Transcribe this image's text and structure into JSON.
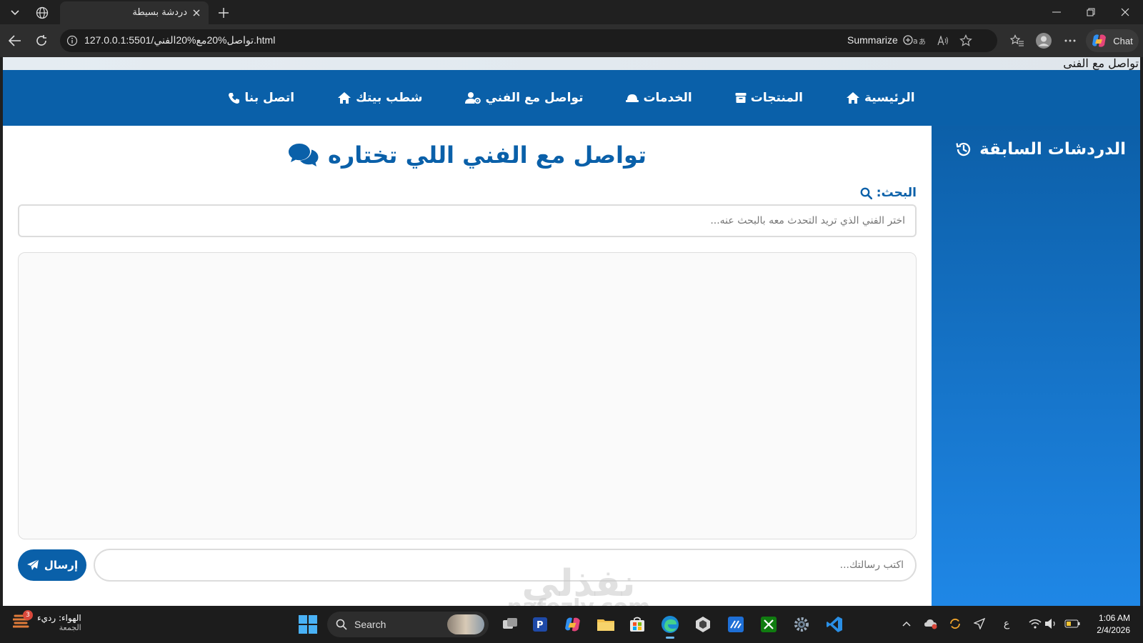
{
  "browser": {
    "tab_title": "دردشة بسيطة",
    "url": "127.0.0.1:5501/تواصل%20مع%20الفني.html",
    "summarize_label": "Summarize",
    "chat_label": "Chat"
  },
  "page": {
    "document_title": "تواصل مع الفنى",
    "nav": [
      {
        "label": "الرئيسية",
        "icon": "home-icon"
      },
      {
        "label": "المنتجات",
        "icon": "box-icon"
      },
      {
        "label": "الخدمات",
        "icon": "hard-hat-icon"
      },
      {
        "label": "تواصل مع الفني",
        "icon": "user-gear-icon"
      },
      {
        "label": "شطب بيتك",
        "icon": "home-icon"
      },
      {
        "label": "اتصل بنا",
        "icon": "phone-icon"
      }
    ],
    "heading": "تواصل مع الفني اللي تختاره",
    "search_label": "البحث:",
    "search_placeholder": "اختر الفني الذي تريد التحدث معه بالبحث عنه...",
    "message_placeholder": "اكتب رسالتك...",
    "send_label": "إرسال",
    "sidebar_title": "الدردشات السابقة",
    "colors": {
      "primary": "#0a60a9",
      "sidebar_gradient_end": "#1f87e6"
    }
  },
  "taskbar": {
    "weather_line1": "الهواء: رديء",
    "weather_line2": "الجمعة",
    "weather_badge": "3",
    "search_label": "Search",
    "input_lang": "ع",
    "time": "1:06 AM",
    "date": "2/4/2026"
  },
  "watermark": {
    "line1": "نفذلي",
    "line2": "nafezly.com"
  }
}
